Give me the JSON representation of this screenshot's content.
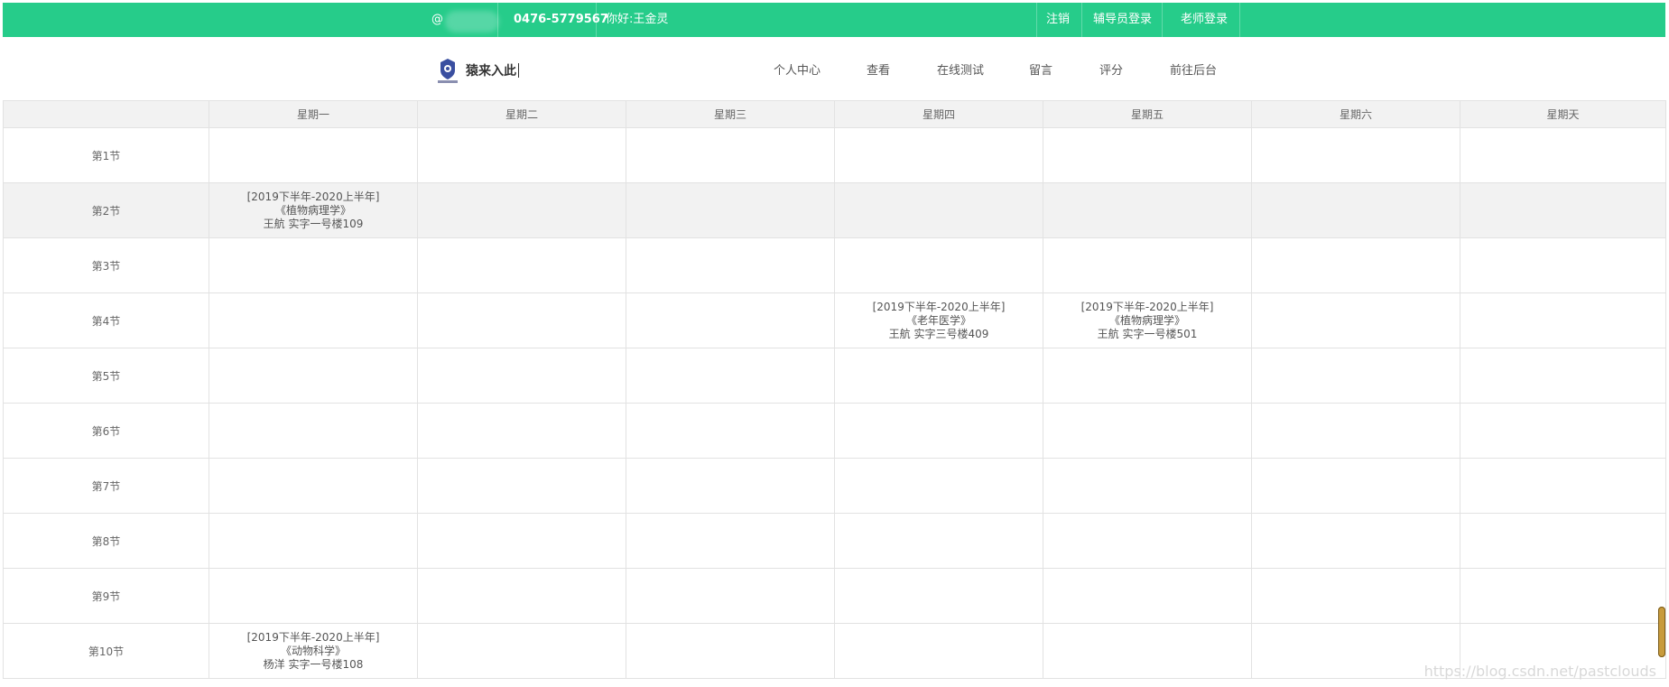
{
  "topbar": {
    "at_symbol": "@",
    "phone": "0476-5779567",
    "greeting": "你好:王金灵",
    "logout": "注销",
    "counselor_login": "辅导员登录",
    "teacher_login": "老师登录",
    "color": "#26cc8a"
  },
  "header": {
    "brand": "猿来入此",
    "nav": [
      "个人中心",
      "查看",
      "在线测试",
      "留言",
      "评分",
      "前往后台"
    ]
  },
  "timetable": {
    "days": [
      "星期一",
      "星期二",
      "星期三",
      "星期四",
      "星期五",
      "星期六",
      "星期天"
    ],
    "rows": [
      {
        "label": "第1节",
        "cells": [
          [],
          [],
          [],
          [],
          [],
          [],
          []
        ]
      },
      {
        "label": "第2节",
        "cells": [
          [
            "[2019下半年-2020上半年]",
            "《植物病理学》",
            "王航   实字一号楼109"
          ],
          [],
          [],
          [],
          [],
          [],
          []
        ]
      },
      {
        "label": "第3节",
        "cells": [
          [],
          [],
          [],
          [],
          [],
          [],
          []
        ]
      },
      {
        "label": "第4节",
        "cells": [
          [],
          [],
          [],
          [
            "[2019下半年-2020上半年]",
            "《老年医学》",
            "王航   实字三号楼409"
          ],
          [
            "[2019下半年-2020上半年]",
            "《植物病理学》",
            "王航   实字一号楼501"
          ],
          [],
          []
        ]
      },
      {
        "label": "第5节",
        "cells": [
          [],
          [],
          [],
          [],
          [],
          [],
          []
        ]
      },
      {
        "label": "第6节",
        "cells": [
          [],
          [],
          [],
          [],
          [],
          [],
          []
        ]
      },
      {
        "label": "第7节",
        "cells": [
          [],
          [],
          [],
          [],
          [],
          [],
          []
        ]
      },
      {
        "label": "第8节",
        "cells": [
          [],
          [],
          [],
          [],
          [],
          [],
          []
        ]
      },
      {
        "label": "第9节",
        "cells": [
          [],
          [],
          [],
          [],
          [],
          [],
          []
        ]
      },
      {
        "label": "第10节",
        "cells": [
          [
            "[2019下半年-2020上半年]",
            "《动物科学》",
            "杨洋   实字一号楼108"
          ],
          [],
          [],
          [],
          [],
          [],
          []
        ]
      }
    ]
  },
  "watermark": "https://blog.csdn.net/pastclouds"
}
